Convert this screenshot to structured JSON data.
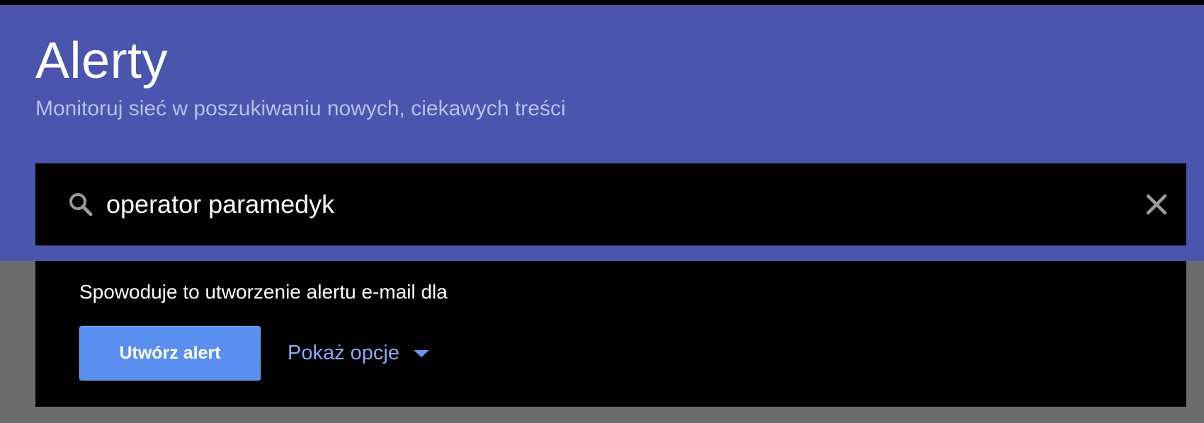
{
  "header": {
    "title": "Alerty",
    "subtitle": "Monitoruj sieć w poszukiwaniu nowych, ciekawych treści"
  },
  "search": {
    "value": "operator paramedyk",
    "search_icon": "search-icon",
    "clear_icon": "close-icon"
  },
  "panel": {
    "description": "Spowoduje to utworzenie alertu e-mail dla",
    "create_button_label": "Utwórz alert",
    "options_label": "Pokaż opcje",
    "options_icon": "caret-down-icon"
  },
  "colors": {
    "header_bg": "#4b55ae",
    "subtitle": "#b9bfe8",
    "button_bg": "#5a8ff0",
    "link": "#8aa8f5"
  }
}
